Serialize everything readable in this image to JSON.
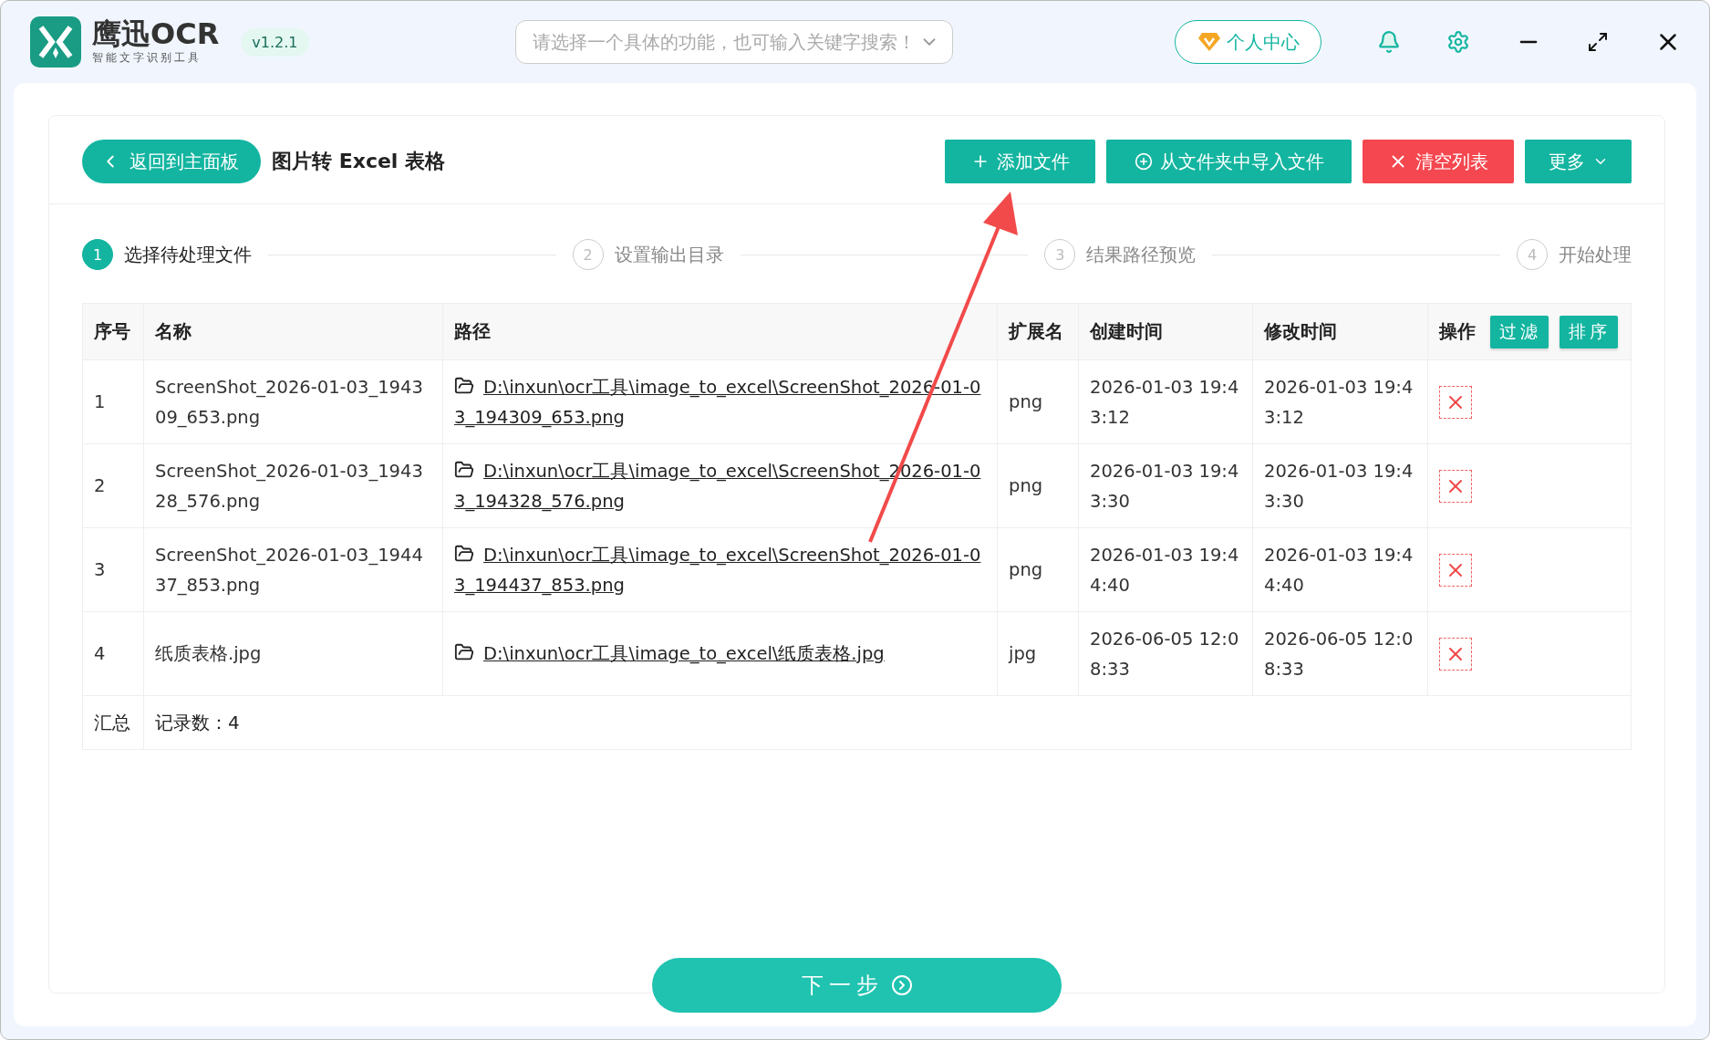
{
  "app": {
    "logo_name": "鹰迅OCR",
    "logo_tagline": "智能文字识别工具",
    "version": "v1.2.1"
  },
  "search": {
    "placeholder": "请选择一个具体的功能，也可输入关键字搜索！"
  },
  "user_button": "个人中心",
  "toolbar": {
    "back": "返回到主面板",
    "title": "图片转 Excel 表格",
    "buttons": [
      {
        "kind": "add",
        "label": "添加文件"
      },
      {
        "kind": "import",
        "label": "从文件夹中导入文件"
      },
      {
        "kind": "clear",
        "label": "清空列表"
      },
      {
        "kind": "more",
        "label": "更多"
      }
    ]
  },
  "steps": [
    {
      "number": "1",
      "label": "选择待处理文件",
      "selected": true
    },
    {
      "number": "2",
      "label": "设置输出目录",
      "selected": false
    },
    {
      "number": "3",
      "label": "结果路径预览",
      "selected": false
    },
    {
      "number": "4",
      "label": "开始处理",
      "selected": false
    }
  ],
  "table": {
    "columns": [
      "序号",
      "名称",
      "路径",
      "扩展名",
      "创建时间",
      "修改时间",
      "操作"
    ],
    "filter_button": "过滤",
    "sort_button": "排序",
    "rows": [
      {
        "index": "1",
        "name": "ScreenShot_2026-01-03_194309_653.png",
        "path": "D:\\inxun\\ocr工具\\image_to_excel\\ScreenShot_2026-01-03_194309_653.png",
        "ext": "png",
        "created": "2026-01-03 19:43:12",
        "modified": "2026-01-03 19:43:12"
      },
      {
        "index": "2",
        "name": "ScreenShot_2026-01-03_194328_576.png",
        "path": "D:\\inxun\\ocr工具\\image_to_excel\\ScreenShot_2026-01-03_194328_576.png",
        "ext": "png",
        "created": "2026-01-03 19:43:30",
        "modified": "2026-01-03 19:43:30"
      },
      {
        "index": "3",
        "name": "ScreenShot_2026-01-03_194437_853.png",
        "path": "D:\\inxun\\ocr工具\\image_to_excel\\ScreenShot_2026-01-03_194437_853.png",
        "ext": "png",
        "created": "2026-01-03 19:44:40",
        "modified": "2026-01-03 19:44:40"
      },
      {
        "index": "4",
        "name": "纸质表格.jpg",
        "path": "D:\\inxun\\ocr工具\\image_to_excel\\纸质表格.jpg",
        "ext": "jpg",
        "created": "2026-06-05 12:08:33",
        "modified": "2026-06-05 12:08:33"
      }
    ],
    "summary": {
      "label": "汇总",
      "count": "记录数：4"
    }
  },
  "next_button": "下一步"
}
